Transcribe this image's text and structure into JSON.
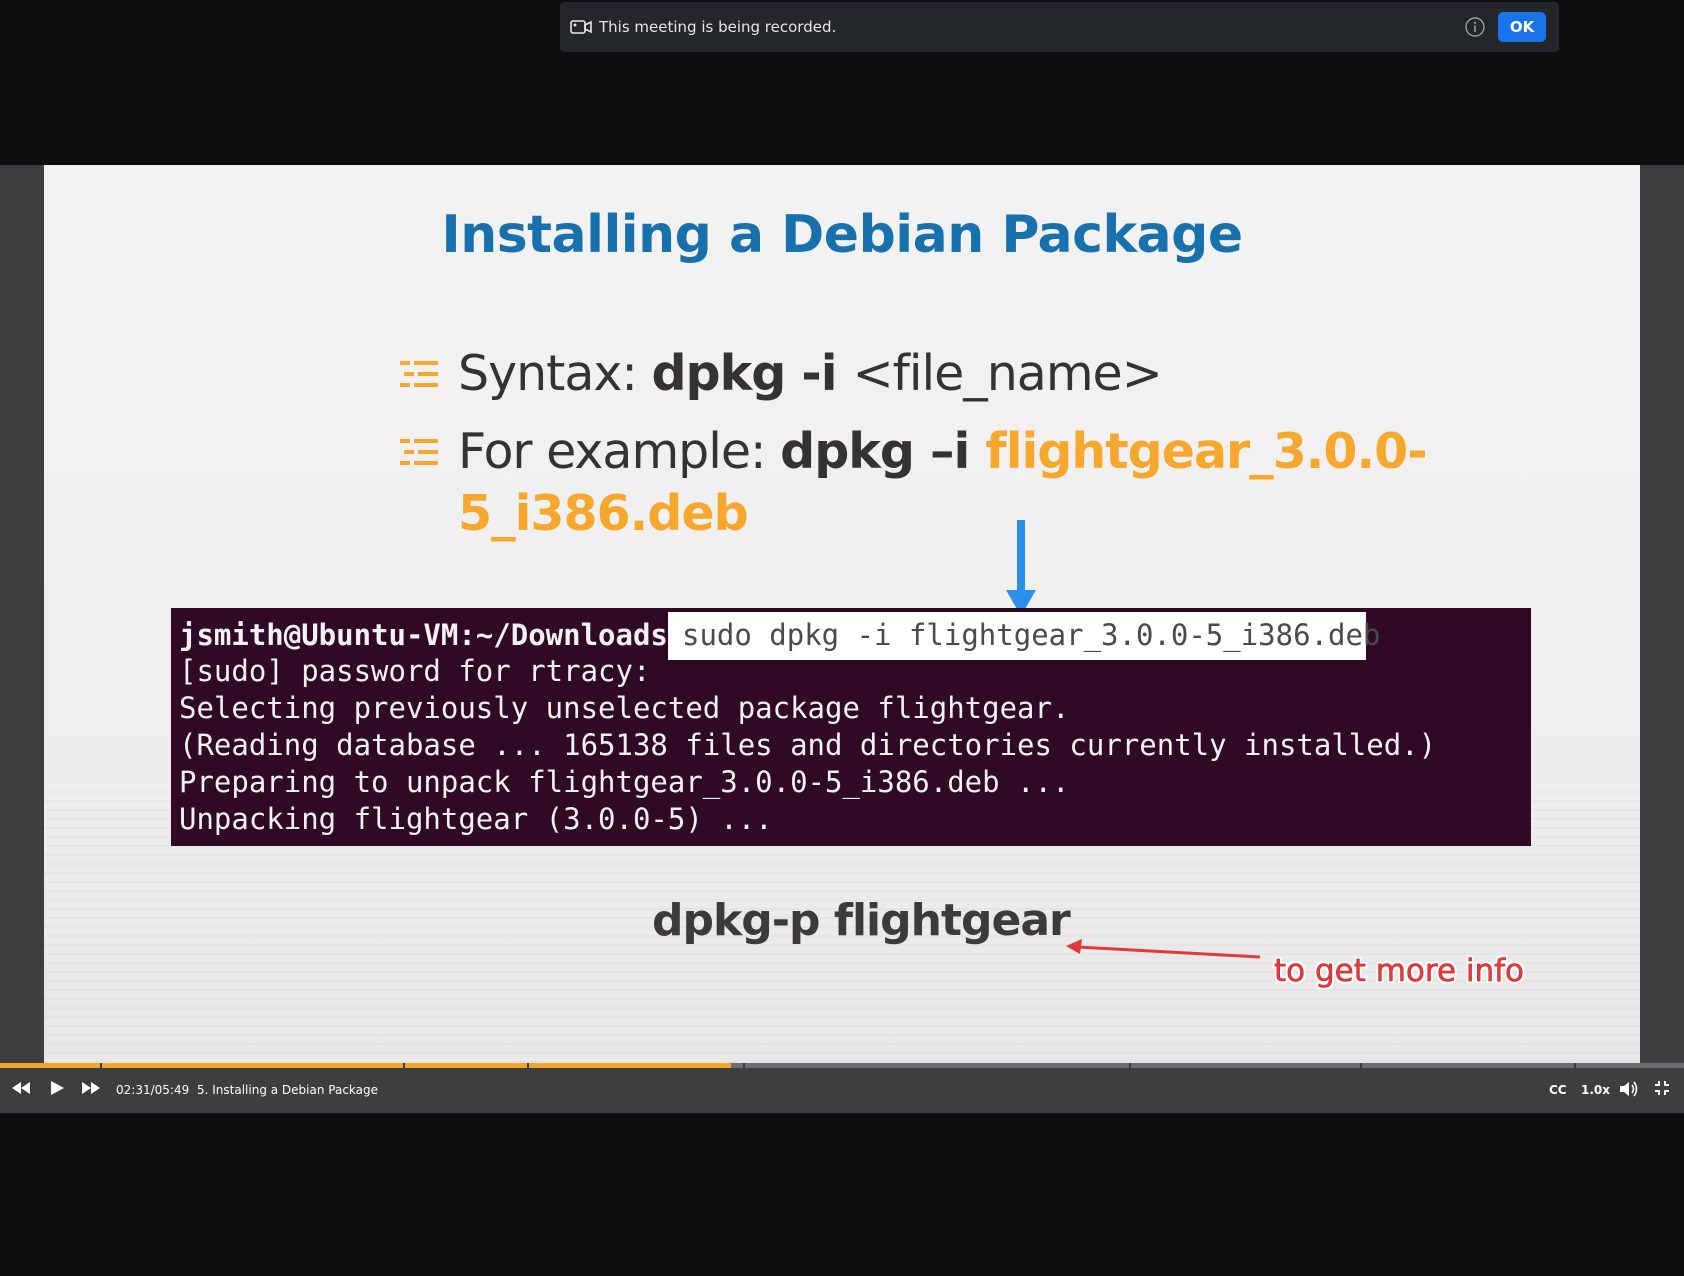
{
  "banner": {
    "message": "This meeting is being recorded.",
    "ok_label": "OK",
    "icons": {
      "camera": "recording-camera-icon",
      "info": "info-icon"
    }
  },
  "slide": {
    "title": "Installing a Debian Package",
    "bullets": [
      {
        "prefix": "Syntax: ",
        "command": "dpkg -i ",
        "argument": "<file_name>"
      },
      {
        "prefix": "For example: ",
        "command": "dpkg –i ",
        "argument": "flightgear_3.0.0-",
        "argument_cont": "5_i386.deb"
      }
    ],
    "terminal": {
      "prompt": "jsmith@Ubuntu-VM:~/Downloads$",
      "command": "sudo dpkg -i flightgear_3.0.0-5_i386.deb",
      "lines": [
        "[sudo] password for rtracy:",
        "Selecting previously unselected package flightgear.",
        "(Reading database ... 165138 files and directories currently installed.)",
        "Preparing to unpack flightgear_3.0.0-5_i386.deb ...",
        "Unpacking flightgear (3.0.0-5) ..."
      ]
    },
    "annotation_command": "dpkg-p flightgear",
    "annotation_note": "to get more info"
  },
  "player": {
    "time": "02:31/05:49",
    "lecture_title": "5. Installing a Debian Package",
    "progress": 0.434,
    "cc_label": "CC",
    "speed_label": "1.0x",
    "colors": {
      "progress": "#f5a623",
      "accent": "#1a73e8"
    }
  }
}
